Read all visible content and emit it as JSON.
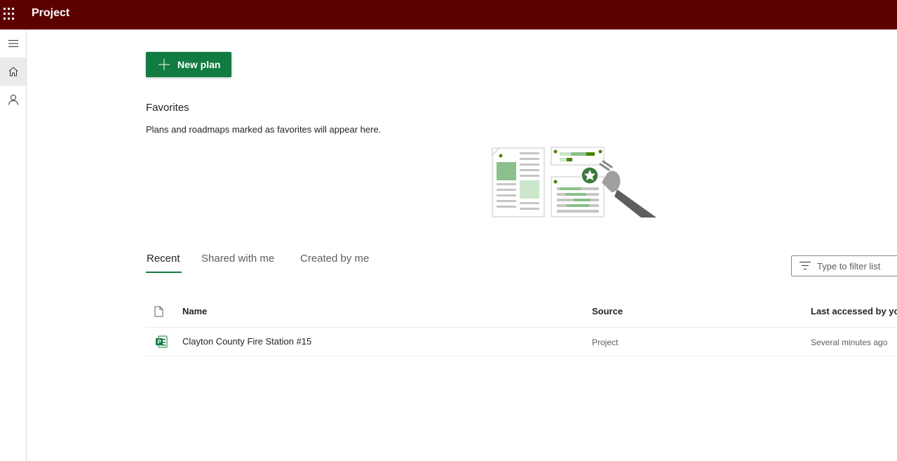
{
  "header": {
    "app_title": "Project",
    "brand_color": "#5c0000",
    "waffle_icon": "app-launcher-icon"
  },
  "rail": {
    "items": [
      {
        "icon": "hamburger-menu-icon"
      },
      {
        "icon": "home-icon",
        "active": true
      },
      {
        "icon": "person-icon"
      }
    ]
  },
  "actions": {
    "new_plan_label": "New plan",
    "accent_color": "#107c41"
  },
  "favorites": {
    "title": "Favorites",
    "description": "Plans and roadmaps marked as favorites will appear here."
  },
  "tabs": [
    {
      "label": "Recent",
      "active": true
    },
    {
      "label": "Shared with me"
    },
    {
      "label": "Created by me"
    }
  ],
  "filter": {
    "placeholder": "Type to filter list"
  },
  "table": {
    "columns": [
      "Name",
      "Source",
      "Last accessed by yo"
    ],
    "rows": [
      {
        "name": "Clayton County Fire Station #15",
        "source": "Project",
        "last_accessed": "Several minutes ago",
        "icon": "project-file-icon"
      }
    ]
  }
}
